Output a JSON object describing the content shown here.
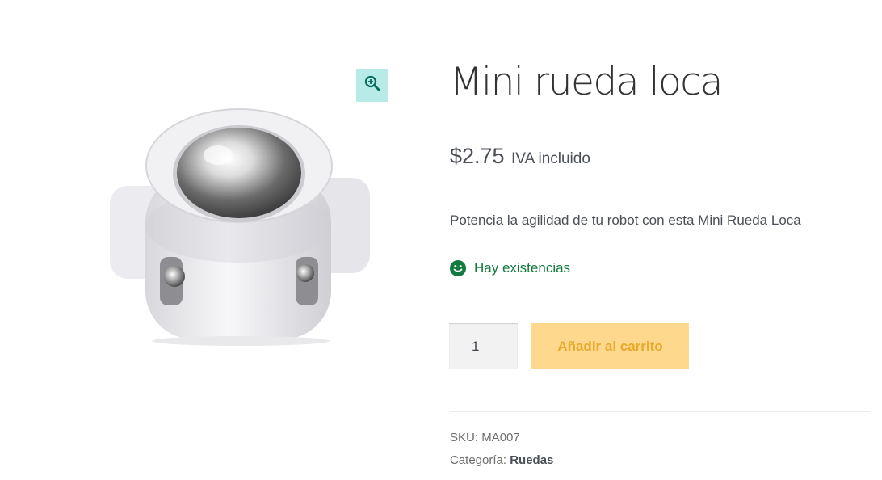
{
  "product": {
    "title": "Mini rueda loca",
    "price": "$2.75",
    "price_suffix": "IVA incluido",
    "short_description": "Potencia la agilidad de tu robot con esta Mini Rueda Loca",
    "stock_status": "Hay existencias",
    "quantity": "1",
    "add_to_cart_label": "Añadir al carrito",
    "sku_label": "SKU:",
    "sku_value": "MA007",
    "category_label": "Categoría:",
    "category_value": "Ruedas"
  },
  "icons": {
    "zoom": "zoom-in-icon",
    "stock": "smiley-icon"
  },
  "colors": {
    "zoom_bg": "#b6ebe8",
    "add_button_bg": "#fed88d",
    "add_button_text": "#e8a92c",
    "stock_green": "#117a3c"
  }
}
